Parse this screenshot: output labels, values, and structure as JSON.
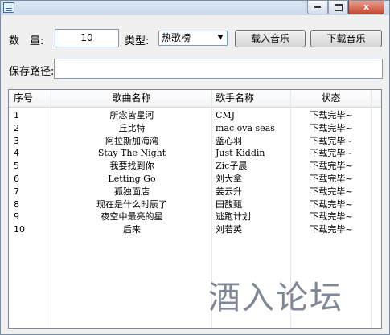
{
  "window": {
    "icon": "app-list-icon",
    "controls": {
      "minimize": "",
      "maximize": "",
      "close": "x"
    }
  },
  "form": {
    "quantity_label": "数　量:",
    "quantity_value": "10",
    "type_label": "类型:",
    "type_selected": "热歌榜",
    "import_button": "载入音乐",
    "download_button": "下载音乐",
    "save_path_label": "保存路径:",
    "save_path_value": ""
  },
  "table": {
    "columns": [
      "序号",
      "歌曲名称",
      "歌手名称",
      "状态"
    ],
    "rows": [
      [
        "1",
        "所念皆星河",
        "CMJ",
        "下载完毕~"
      ],
      [
        "2",
        "丘比特",
        "mac ova seas",
        "下载完毕~"
      ],
      [
        "3",
        "阿拉斯加海湾",
        "蓝心羽",
        "下载完毕~"
      ],
      [
        "4",
        "Stay The Night",
        "Just Kiddin",
        "下载完毕~"
      ],
      [
        "5",
        "我要找到你",
        "Zic子晨",
        "下载完毕~"
      ],
      [
        "6",
        "Letting Go",
        "刘大拿",
        "下载完毕~"
      ],
      [
        "7",
        "孤独面店",
        "姜云升",
        "下载完毕~"
      ],
      [
        "8",
        "现在是什么时辰了",
        "田馥甄",
        "下载完毕~"
      ],
      [
        "9",
        "夜空中最亮的星",
        "逃跑计划",
        "下载完毕~"
      ],
      [
        "10",
        "后来",
        "刘若英",
        "下载完毕~"
      ]
    ]
  },
  "watermark": "酒入论坛"
}
